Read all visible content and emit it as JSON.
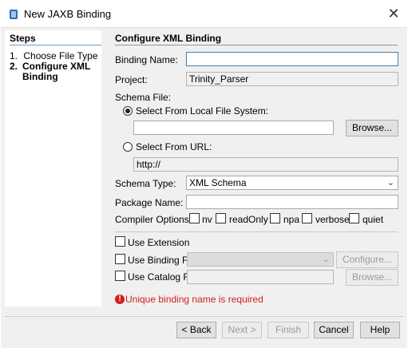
{
  "window": {
    "title": "New JAXB Binding",
    "close_icon": "close-icon"
  },
  "steps": {
    "title": "Steps",
    "items": [
      {
        "num": "1.",
        "label": "Choose File Type"
      },
      {
        "num": "2.",
        "label": "Configure XML Binding"
      }
    ]
  },
  "config": {
    "title": "Configure XML Binding",
    "binding_name_label": "Binding Name:",
    "binding_name_value": "",
    "project_label": "Project:",
    "project_value": "Trinity_Parser",
    "schema_file_label": "Schema File:",
    "local_fs_label": "Select From Local File System:",
    "local_fs_value": "",
    "browse_label": "Browse...",
    "url_label": "Select From URL:",
    "url_value": "http://",
    "schema_type_label": "Schema Type:",
    "schema_type_value": "XML Schema",
    "package_name_label": "Package Name:",
    "package_name_value": "",
    "compiler_options_label": "Compiler Options:",
    "compiler_options": [
      "nv",
      "readOnly",
      "npa",
      "verbose",
      "quiet"
    ],
    "use_extension_label": "Use Extension",
    "use_binding_file_label": "Use Binding File",
    "configure_label": "Configure...",
    "use_catalog_file_label": "Use Catalog File",
    "browse2_label": "Browse...",
    "error_text": "Unique binding name is required"
  },
  "footer": {
    "back_label": "< Back",
    "next_label": "Next >",
    "finish_label": "Finish",
    "cancel_label": "Cancel",
    "help_label": "Help"
  },
  "colors": {
    "error": "#d21f1f",
    "rule": "#7a9bb5"
  }
}
